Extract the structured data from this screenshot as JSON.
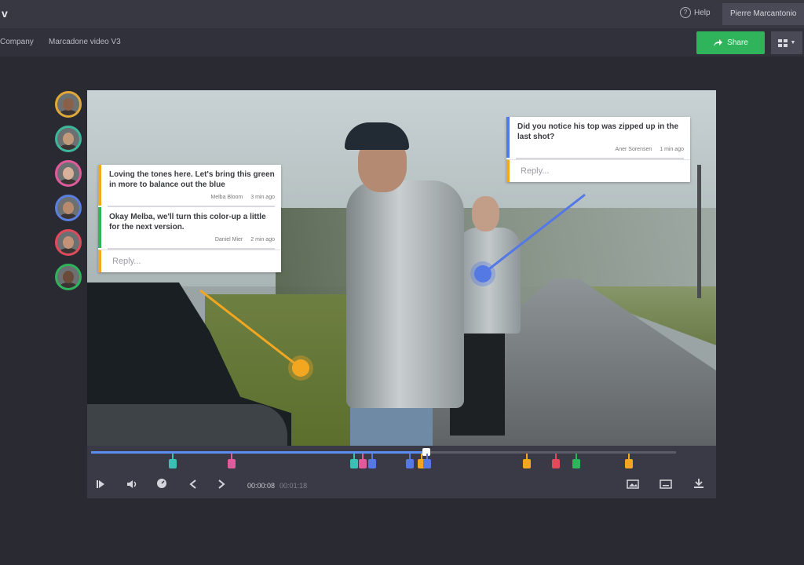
{
  "app": {
    "logo": "v",
    "help_label": "Help",
    "user_button": "Pierre Marcantonio"
  },
  "breadcrumb": {
    "company": "Company",
    "project": "Marcadone video V3"
  },
  "toolbar": {
    "share_label": "Share",
    "view_label": "▼"
  },
  "participants": [
    {
      "ring": "#e0a838",
      "skin": "#8a6048"
    },
    {
      "ring": "#3bb89b",
      "skin": "#c09a7a"
    },
    {
      "ring": "#e05a9c",
      "skin": "#d9b09a"
    },
    {
      "ring": "#5a7fe0",
      "skin": "#b98b6e"
    },
    {
      "ring": "#e04a5a",
      "skin": "#c49279"
    },
    {
      "ring": "#2fb45c",
      "skin": "#6a4a38"
    }
  ],
  "threads": {
    "left": {
      "comments": [
        {
          "text": "Loving the tones here. Let's bring this green in more to balance out the blue",
          "author": "Melba Bloom",
          "time": "3 min ago",
          "color": "#f3a721"
        },
        {
          "text": "Okay Melba, we'll turn this color-up a little for the next version.",
          "author": "Daniel Mier",
          "time": "2 min ago",
          "color": "#2fb45c"
        }
      ],
      "reply_placeholder": "Reply..."
    },
    "right": {
      "comments": [
        {
          "text": "Did you notice his top was zipped up in the last shot?",
          "author": "Aner Sorensen",
          "time": "1 min ago",
          "color": "#5478e4"
        }
      ],
      "reply_placeholder": "Reply..."
    }
  },
  "playback": {
    "progress": 0.57,
    "current_time": "00:00:08",
    "duration": "00:01:18"
  },
  "markers": [
    {
      "pos": 0.14,
      "color": "#3bc0b6"
    },
    {
      "pos": 0.24,
      "color": "#e05a9c"
    },
    {
      "pos": 0.45,
      "color": "#3bc0b6"
    },
    {
      "pos": 0.465,
      "color": "#e05a9c"
    },
    {
      "pos": 0.48,
      "color": "#5478e4"
    },
    {
      "pos": 0.545,
      "color": "#5478e4"
    },
    {
      "pos": 0.565,
      "color": "#f3a721"
    },
    {
      "pos": 0.575,
      "color": "#5478e4"
    },
    {
      "pos": 0.745,
      "color": "#f3a721"
    },
    {
      "pos": 0.795,
      "color": "#e04a5a"
    },
    {
      "pos": 0.83,
      "color": "#2fb45c"
    },
    {
      "pos": 0.92,
      "color": "#f3a721"
    }
  ],
  "controls": {
    "play_icon": "play-icon",
    "volume_icon": "volume-icon",
    "speed_icon": "speed-icon",
    "prev_icon": "prev-frame-icon",
    "next_icon": "next-frame-icon",
    "frame_icon": "frame-icon",
    "caption_icon": "caption-icon",
    "download_icon": "download-icon"
  }
}
